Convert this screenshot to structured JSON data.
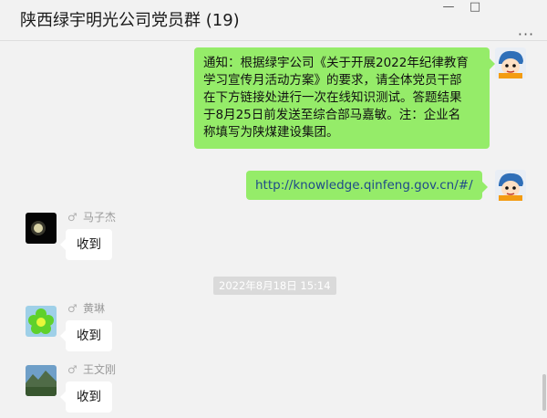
{
  "header": {
    "title": "陕西绿宇明光公司党员群 (19)",
    "more_icon": "ellipsis-icon"
  },
  "messages": [
    {
      "sender": "self",
      "text": "通知：根据绿宇公司《关于开展2022年纪律教育学习宣传月活动方案》的要求，请全体党员干部在下方链接处进行一次在线知识测试。答题结果于8月25日前发送至综合部马嘉敏。注：企业名称填写为陕煤建设集团。",
      "lines": [
        "通知：根据绿宇公司《关于开展2022年纪律教育",
        "学习宣传月活动方案》的要求，请全体党员干部",
        "在下方链接处进行一次在线知识测试。答题结果",
        "于8月25日前发送至综合部马嘉敏。注：企业名",
        "称填写为陕煤建设集团。"
      ]
    },
    {
      "sender": "self",
      "text": "http://knowledge.qinfeng.gov.cn/#/"
    },
    {
      "sender": "马子杰",
      "text": "收到"
    },
    {
      "sender": "黄琳",
      "text": "收到"
    },
    {
      "sender": "王文刚",
      "text": "收到"
    }
  ],
  "timestamp": "2022年8月18日 15:14",
  "colors": {
    "self_bubble": "#95ec69",
    "other_bubble": "#ffffff",
    "background": "#f2f2f2"
  }
}
